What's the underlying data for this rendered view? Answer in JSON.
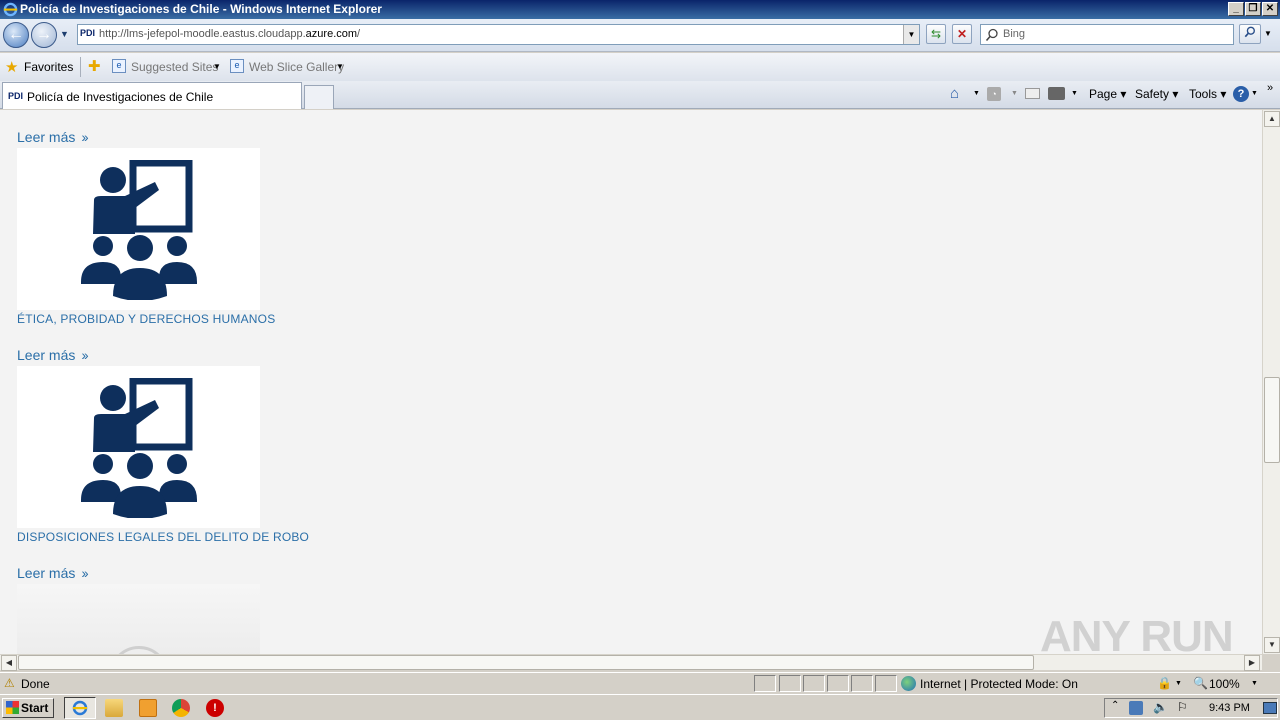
{
  "window": {
    "title": "Policía de Investigaciones de Chile - Windows Internet Explorer",
    "controls": {
      "minimize": "_",
      "restore": "❐",
      "close": "✕"
    }
  },
  "address_bar": {
    "site_badge": "PDI",
    "url_prefix": "http://lms-jefepol-moodle.eastus.cloudapp.",
    "url_domain": "azure.com",
    "url_suffix": "/",
    "search_placeholder": "Bing"
  },
  "favorites_bar": {
    "favorites_label": "Favorites",
    "suggested_sites": "Suggested Sites",
    "web_slice_gallery": "Web Slice Gallery"
  },
  "tab": {
    "badge": "PDI",
    "label": "Policía de Investigaciones de Chile"
  },
  "command_bar": {
    "page": "Page",
    "safety": "Safety",
    "tools": "Tools"
  },
  "content": {
    "read_more": "Leer más",
    "courses": [
      {
        "title": "ÉTICA, PROBIDAD Y DERECHOS HUMANOS",
        "icon": "classroom-teacher-icon"
      },
      {
        "title": "DISPOSICIONES LEGALES DEL DELITO DE ROBO",
        "icon": "classroom-teacher-icon"
      }
    ],
    "accent_color": "#2b6fa8",
    "icon_color": "#0e2f5c"
  },
  "status_bar": {
    "status": "Done",
    "zone": "Internet | Protected Mode: On",
    "zoom": "100%"
  },
  "taskbar": {
    "start": "Start",
    "time": "9:43 PM"
  },
  "watermark": "ANY RUN"
}
